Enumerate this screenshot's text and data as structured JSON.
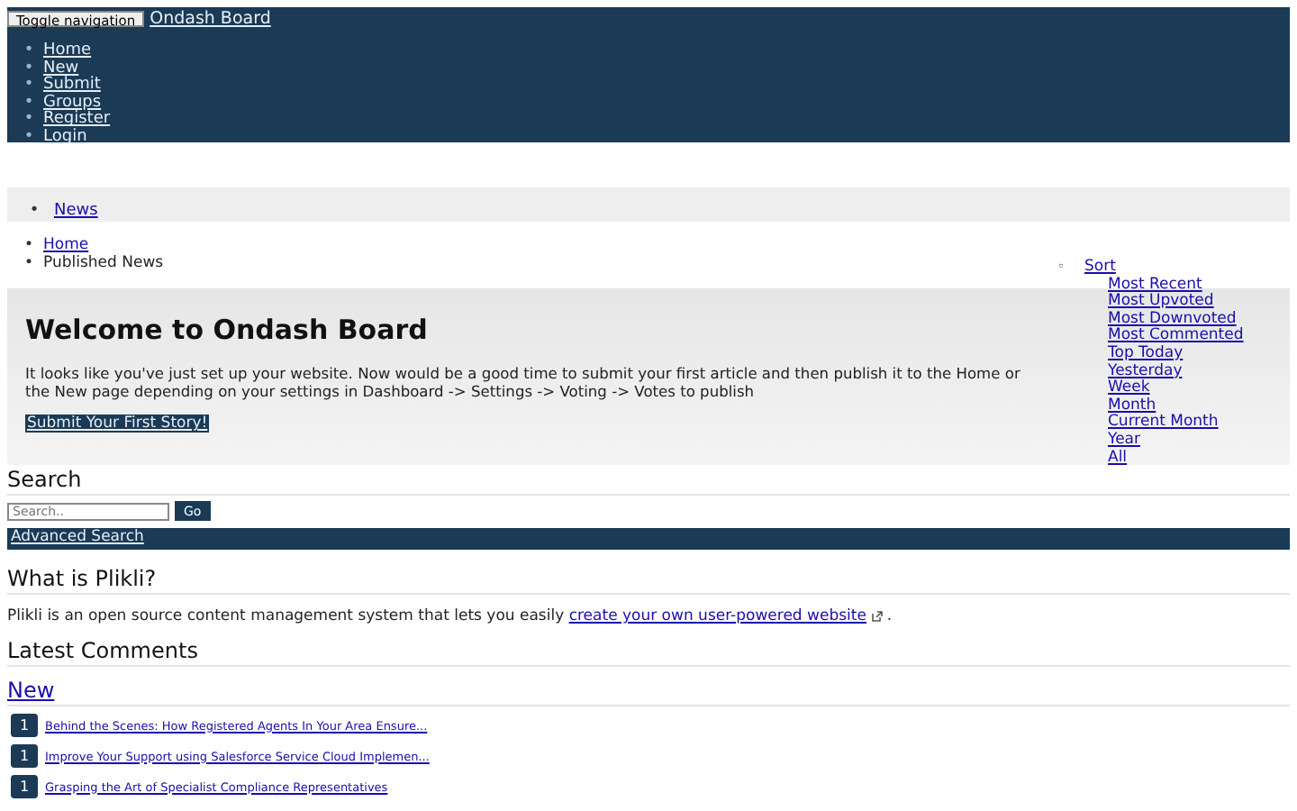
{
  "navbar": {
    "toggle_button": "Toggle navigation",
    "brand": "Ondash Board",
    "marker": "•",
    "items": [
      "Home",
      "New",
      "Submit",
      "Groups",
      "Register",
      "Login"
    ]
  },
  "category_bar": {
    "marker": "•",
    "items": [
      {
        "label": "News"
      }
    ]
  },
  "breadcrumb": [
    {
      "marker": "•",
      "label": "Home",
      "kind": "link"
    },
    {
      "marker": "•",
      "label": "Published News",
      "kind": "text"
    }
  ],
  "sort_menu": {
    "marker": "◦",
    "label": "Sort",
    "options": [
      "Most Recent",
      "Most Upvoted",
      "Most Downvoted",
      "Most Commented",
      "Top Today",
      "Yesterday",
      "Week",
      "Month",
      "Current Month",
      "Year",
      "All"
    ]
  },
  "welcome": {
    "title": "Welcome to Ondash Board",
    "text": "It looks like you've just set up your website. Now would be a good time to submit your first article and then publish it to the Home or the New page depending on your settings in Dashboard -> Settings -> Voting -> Votes to publish",
    "button": "Submit Your First Story!"
  },
  "search": {
    "title": "Search",
    "placeholder": "Search..",
    "button": "Go",
    "advanced": "Advanced Search"
  },
  "about": {
    "title": "What is Plikli?",
    "text": "Plikli is an open source content management system that lets you easily",
    "link": "create your own user-powered website",
    "after": "."
  },
  "comments": {
    "title": "Latest Comments",
    "tab": "New",
    "items": [
      {
        "count": "1",
        "title": "Behind the Scenes: How Registered Agents In Your Area Ensure..."
      },
      {
        "count": "1",
        "title": "Improve Your Support using Salesforce Service Cloud Implemen..."
      },
      {
        "count": "1",
        "title": "Grasping the Art of Specialist Compliance Representatives"
      }
    ]
  }
}
